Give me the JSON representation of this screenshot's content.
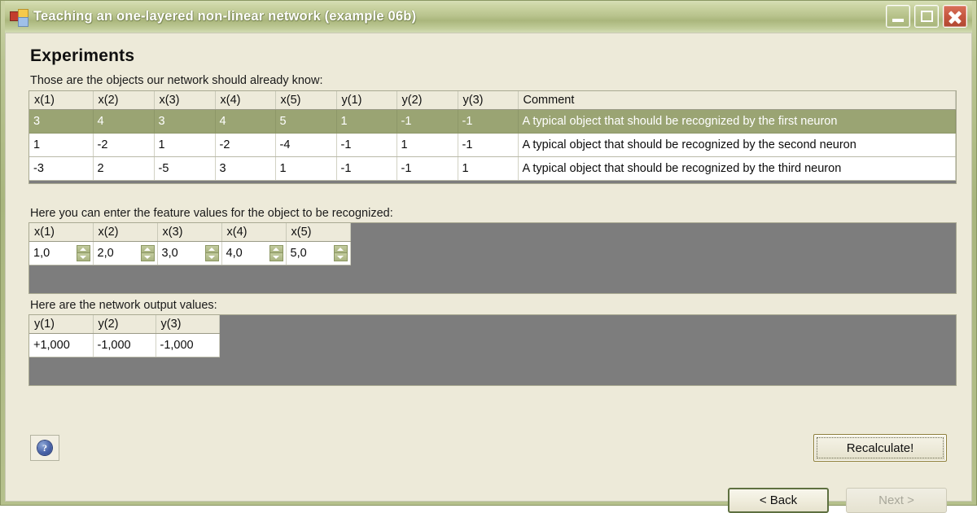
{
  "window": {
    "title": "Teaching an one-layered non-linear network (example 06b)",
    "icon": "app-blocks-icon",
    "caption": {
      "minimize_label": "Minimize",
      "maximize_label": "Maximize",
      "close_label": "Close"
    }
  },
  "page": {
    "heading": "Experiments",
    "known_objects_label": "Those are the objects our network should already know:",
    "feature_values_label": "Here you can enter the feature values for the object to be recognized:",
    "output_values_label": "Here are the network output values:"
  },
  "known_objects_table": {
    "columns": [
      "x(1)",
      "x(2)",
      "x(3)",
      "x(4)",
      "x(5)",
      "y(1)",
      "y(2)",
      "y(3)",
      "Comment"
    ],
    "rows": [
      {
        "selected": true,
        "cells": [
          "3",
          "4",
          "3",
          "4",
          "5",
          "1",
          "-1",
          "-1",
          "A typical object that should be recognized by the first neuron"
        ]
      },
      {
        "selected": false,
        "cells": [
          "1",
          "-2",
          "1",
          "-2",
          "-4",
          "-1",
          "1",
          "-1",
          "A typical object that should be recognized by the second neuron"
        ]
      },
      {
        "selected": false,
        "cells": [
          "-3",
          "2",
          "-5",
          "3",
          "1",
          "-1",
          "-1",
          "1",
          "A typical object that should be recognized by the third neuron"
        ]
      }
    ]
  },
  "feature_values_table": {
    "columns": [
      "x(1)",
      "x(2)",
      "x(3)",
      "x(4)",
      "x(5)"
    ],
    "values": [
      "1,0",
      "2,0",
      "3,0",
      "4,0",
      "5,0"
    ]
  },
  "output_values_table": {
    "columns": [
      "y(1)",
      "y(2)",
      "y(3)"
    ],
    "values": [
      "+1,000",
      "-1,000",
      "-1,000"
    ]
  },
  "buttons": {
    "help_label": "?",
    "recalculate_label": "Recalculate!",
    "back_label": "< Back",
    "next_label": "Next >"
  },
  "colors": {
    "titlebar_olive": "#b9c48e",
    "selection_olive": "#9aa473",
    "client_bg": "#edead9",
    "grid_filler_gray": "#7d7d7d",
    "close_red": "#c4553d"
  }
}
